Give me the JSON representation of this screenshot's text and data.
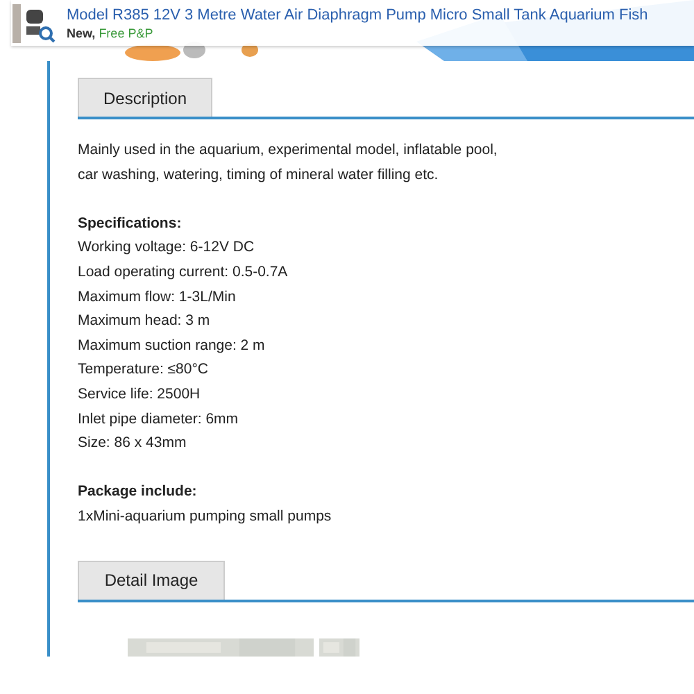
{
  "header": {
    "title": "Model R385 12V 3 Metre Water Air Diaphragm Pump Micro Small Tank Aquarium Fish",
    "condition": "New,",
    "shipping": "Free P&P"
  },
  "tabs": [
    {
      "label": "Description"
    },
    {
      "label": "Detail Image"
    }
  ],
  "intro": [
    "Mainly used in the aquarium, experimental model, inflatable pool,",
    "car washing, watering, timing of mineral water filling etc."
  ],
  "specifications": {
    "heading": "Specifications:",
    "items": [
      "Working voltage: 6-12V DC",
      "Load operating current: 0.5-0.7A",
      "Maximum flow: 1-3L/Min",
      "Maximum head: 3 m",
      "Maximum suction range: 2 m",
      "Temperature: ≤80°C",
      "Service life: 2500H",
      "Inlet pipe diameter: 6mm",
      "Size: 86 x 43mm"
    ]
  },
  "package": {
    "heading": "Package include:",
    "items": [
      "1xMini-aquarium pumping small pumps"
    ]
  }
}
